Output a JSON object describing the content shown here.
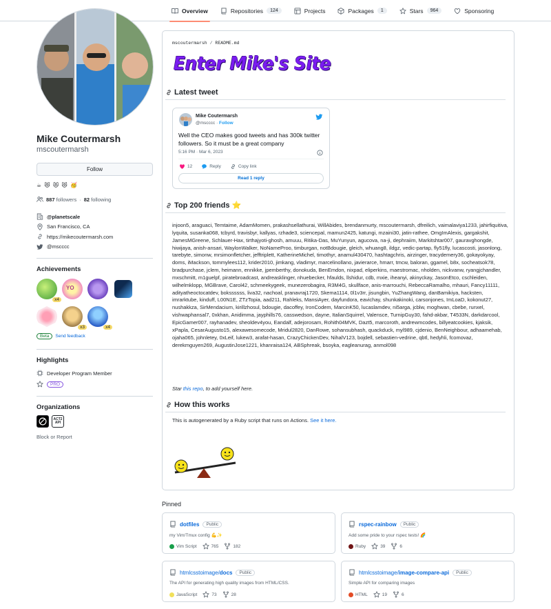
{
  "nav": {
    "tabs": [
      {
        "label": "Overview",
        "count": ""
      },
      {
        "label": "Repositories",
        "count": "124"
      },
      {
        "label": "Projects",
        "count": ""
      },
      {
        "label": "Packages",
        "count": "1"
      },
      {
        "label": "Stars",
        "count": "964"
      },
      {
        "label": "Sponsoring",
        "count": ""
      }
    ]
  },
  "profile": {
    "name": "Mike Coutermarsh",
    "login": "mscoutermarsh",
    "follow_label": "Follow",
    "status_emoji": "☕ 😻 😻 😻 🥳",
    "followers_count": "887",
    "followers_label": "followers",
    "following_count": "82",
    "following_label": "following",
    "company": "@planetscale",
    "location": "San Francisco, CA",
    "website": "https://mikecoutermarsh.com",
    "twitter": "@mscccc"
  },
  "achievements": {
    "title": "Achievements",
    "badges": [
      {
        "name": "pair-extraordinaire",
        "count": "x4",
        "color": "#7ac943"
      },
      {
        "name": "yolo",
        "count": "",
        "color": "#f5a9c9"
      },
      {
        "name": "galaxy-brain",
        "count": "",
        "color": "#8a5cd6"
      },
      {
        "name": "starstruck",
        "count": "",
        "color": "#3d7fd8"
      },
      {
        "name": "heart-on-your-sleeve",
        "count": "",
        "color": "#f08fa5"
      },
      {
        "name": "quickdraw",
        "count": "x3",
        "color": "#e8b84a"
      },
      {
        "name": "pull-shark",
        "count": "x4",
        "color": "#3a76d1"
      }
    ],
    "beta_label": "Beta",
    "feedback_label": "Send feedback"
  },
  "highlights": {
    "title": "Highlights",
    "items": [
      "Developer Program Member"
    ],
    "pro_label": "PRO"
  },
  "organizations": {
    "title": "Organizations",
    "org2_text": "ACT2 API",
    "block_label": "Block or Report"
  },
  "readme": {
    "owner": "mscoutermarsh",
    "file": "README.md",
    "site_title": "Enter Mike's Site",
    "latest_tweet_heading": "Latest tweet",
    "tweet": {
      "name": "Mike Coutermarsh",
      "handle": "@mscccc",
      "follow": "Follow",
      "text": "Well the CEO makes good tweets and has 300k twitter followers. So it must be a great company",
      "time": "5:16 PM · Mar 6, 2023",
      "likes": "12",
      "reply": "Reply",
      "copy": "Copy link",
      "read_reply": "Read 1 reply"
    },
    "friends_heading": "Top 200 friends ⭐",
    "friends_text": "injoon5, araguaci, Temtaime, AdamMomen, prakashsellathurai, WillAbides, brendanmurty, mscoutermarsh, dfreilich, vaimalaviya1233, jahirfiquitiva, lyquita, susanka068, tcbyrd, travisbyr, kallyas, rzhade3, sciencepal, mamun2425, katungi, mzaini30, jatin-rathee, OmgImAlexis, gargakshit, JamesMGreene, Schlauer-Hax, tirthajyoti-ghosh, amuuu, Ritika-Das, MuYunyun, agucova, na-ji, dephraiim, Markitshtar007, gauravghongde, hiwijaya, anish-ansari, WaylonWalker, NoNameProo, timburgan, notBdougie, gleich, whuang8, ildgz, vedic-partap, fly51fly, lucascosti, jasonlong, tarebyte, simonw, mrsimonfletcher, jefftriplett, KatherineMichel, timothyr, anamul430470, hashtagchris, airzinger, tracydemery36, gokayokyay, doms, iMackson, tommylees112, krider2010, jimkang, vladimyr, marcelinollano, javierarce, hmarr, tmcw, baloran, ggamel, b8x, socheatsok78, bradpurchase, jclem, heimann, ennikke, jpemberthy, donokuda, BenEmdon, nixpad, eliperkins, maestromac, nholden, nickvanw, ryangjchandler, mxschmitt, m1guelpf, piratebroadcast, andreasklinger, nhuebecker, hfaulds, llshidur, cdb, mxie, iheanyi, akinyckay, JasonEtco, cschleiden, wilhelmklopp, MGBrave, Carol42, schmeekygeek, munezerobagira, R3M4G, skullface, anis-marrouchi, RebeccaRamalho, mhauri, Fancy11111, adityatheoctocatdev, bokssssss, liva32, nachoal, pranavraj1720, Skema1114, 0l1v3rr, jisungbin, YuZhangWang, danBamikiya, hacksten, imrarktube, kinduff, L00N1E, ZTzTopia, aad211, Rahleks, MansiAyer, dayfundora, eavichay, shunkakinoki, carsonjones, ImLoaD, kokonut27, nushakkza, SirMendacium, kirillzhosul, bdougie, dacoffey, IronCodem, MarcinK50, lucaslamdev, ni5arga, jcblw, moghwan, cbebe, runxel, vishwaphansal7, 0xkhan, Anidimma, jayphills76, casswedson, dayne, ItalianSquirrel, Valensce, TurnipGuy30, fahd-akbar, T4533N, darkdarcool, EpicGamer007, rayhanadev, sheoldev4you, Eandalf, adejorosam, Rohith04MVK, Dazt5, marcoroth, andrewmcodes, billyeatcookies, kjaksik, xPapla, CesarAugusto15, alexawesomecode, Mridul2820, DanRowe, sohansubhash, quackduck, myl989, cjdenio, BenNeighbour, adhaamehab, ojaha065, johnletey, 0xLeif, lukew3, arafat-hasan, CrazyChickenDev, NihalV123, bojdell, sebastien-vedrine, qbtl, hedyhli, fcomovaz, derekmguyen269, AugustinJose1221, khanraisa124, ABSphreak, bsoyka, eagleanurag, anmol098",
    "star_prefix": "Star",
    "star_link": "this repo",
    "star_suffix": ", to add yourself here.",
    "how_heading": "How this works",
    "how_text": "This is autogenerated by a Ruby script that runs on Actions.",
    "how_link": "See it here."
  },
  "pinned": {
    "title": "Pinned",
    "repos": [
      {
        "owner": "",
        "name": "dotfiles",
        "visibility": "Public",
        "desc": "my Vim/Tmux config 💪✨",
        "lang": "Vim Script",
        "lang_color": "#199f4b",
        "stars": "765",
        "forks": "182"
      },
      {
        "owner": "",
        "name": "rspec-rainbow",
        "visibility": "Public",
        "desc": "Add some pride to your rspec tests! 🌈",
        "lang": "Ruby",
        "lang_color": "#701516",
        "stars": "39",
        "forks": "6"
      },
      {
        "owner": "htmlcsstoimage/",
        "name": "docs",
        "visibility": "Public",
        "desc": "The API for generating high quality images from HTML/CSS.",
        "lang": "JavaScript",
        "lang_color": "#f1e05a",
        "stars": "73",
        "forks": "28"
      },
      {
        "owner": "htmlcsstoimage/",
        "name": "image-compare-api",
        "visibility": "Public",
        "desc": "Simple API for comparing images",
        "lang": "HTML",
        "lang_color": "#e34c26",
        "stars": "19",
        "forks": "6"
      }
    ]
  }
}
